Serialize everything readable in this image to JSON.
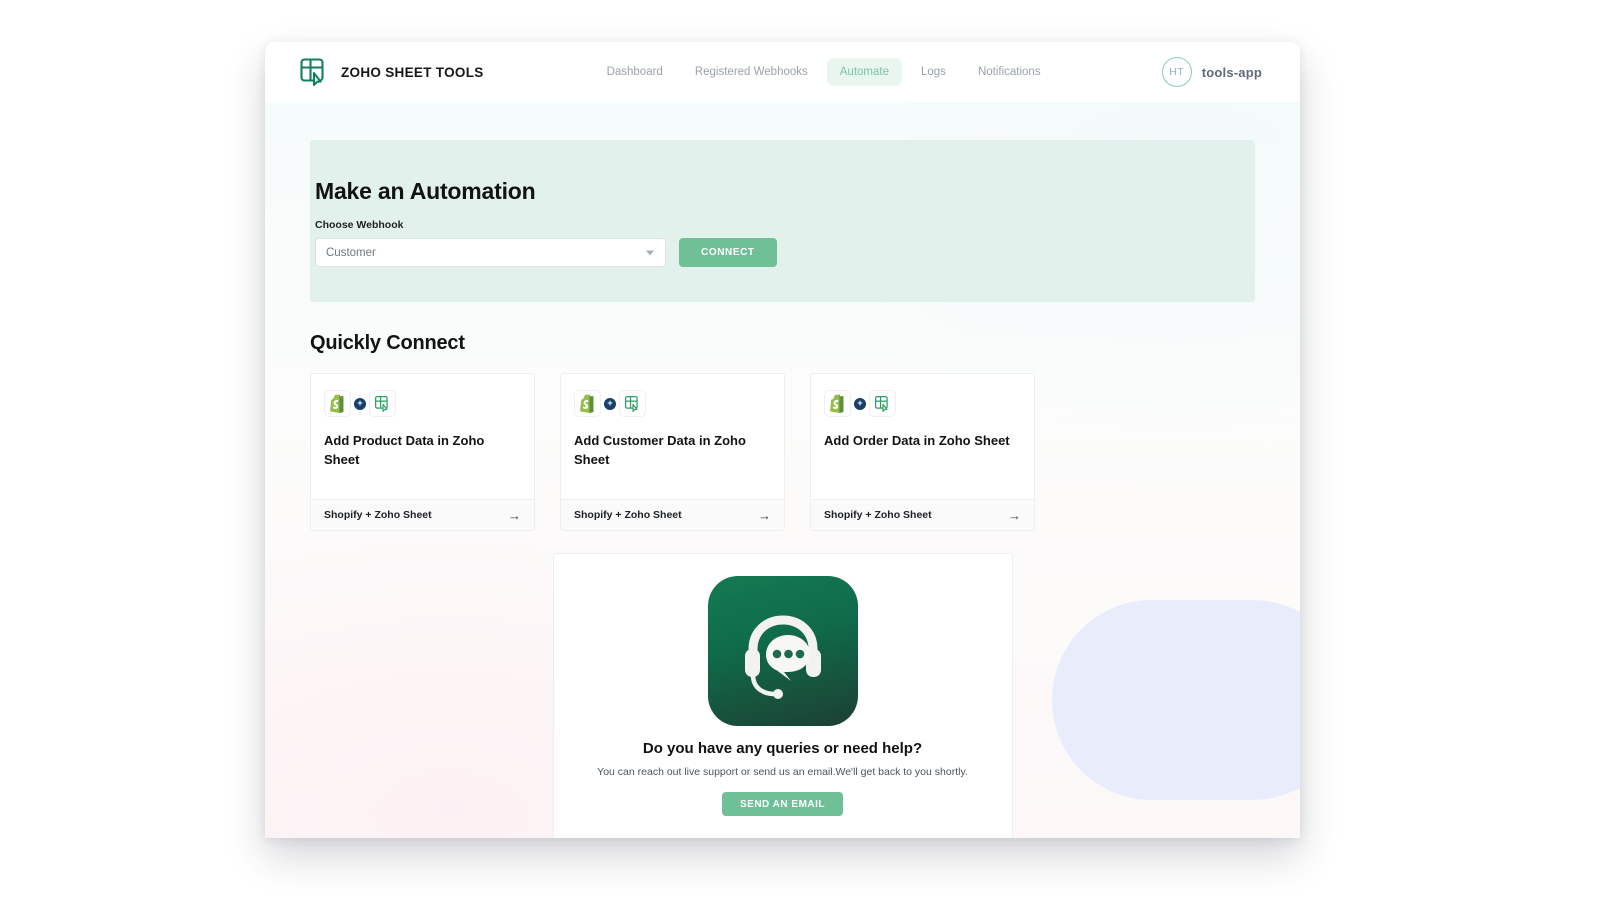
{
  "header": {
    "brand_name": "ZOHO SHEET TOOLS",
    "logo_icon": "zoho-sheet-cursor-icon",
    "nav_items": [
      {
        "label": "Dashboard",
        "active": false
      },
      {
        "label": "Registered Webhooks",
        "active": false
      },
      {
        "label": "Automate",
        "active": true
      },
      {
        "label": "Logs",
        "active": false
      },
      {
        "label": "Notifications",
        "active": false
      }
    ],
    "account": {
      "avatar_initials": "HT",
      "name": "tools-app"
    }
  },
  "automation": {
    "title": "Make an Automation",
    "webhook_label": "Choose Webhook",
    "webhook_value": "Customer",
    "webhook_placeholder": "Customer",
    "caret_icon": "chevron-down-icon",
    "connect_label": "CONNECT"
  },
  "quick_connect": {
    "title": "Quickly Connect",
    "cards": [
      {
        "title": "Add Product Data in Zoho Sheet",
        "apps": "Shopify  + Zoho Sheet",
        "arrow": "→",
        "source_icon": "shopify-icon",
        "plus_icon": "plus-badge-icon",
        "target_icon": "zoho-sheet-icon"
      },
      {
        "title": "Add Customer Data in Zoho Sheet",
        "apps": "Shopify  + Zoho Sheet",
        "arrow": "→",
        "source_icon": "shopify-icon",
        "plus_icon": "plus-badge-icon",
        "target_icon": "zoho-sheet-icon"
      },
      {
        "title": "Add Order Data in Zoho Sheet",
        "apps": "Shopify  + Zoho Sheet",
        "arrow": "→",
        "source_icon": "shopify-icon",
        "plus_icon": "plus-badge-icon",
        "target_icon": "zoho-sheet-icon"
      }
    ]
  },
  "support": {
    "icon": "headset-support-chat-icon",
    "title": "Do you have any queries or need help?",
    "description": "You can reach out live support or send us an email.We'll get back to you shortly.",
    "button_label": "SEND AN EMAIL"
  },
  "colors": {
    "accent_green": "#6fc096",
    "brand_green": "#118058",
    "banner_bg": "#e3f1ec",
    "nav_active_bg": "#e9f6ef",
    "plus_badge": "#18406b",
    "decor_blob": "#e9edfb"
  }
}
